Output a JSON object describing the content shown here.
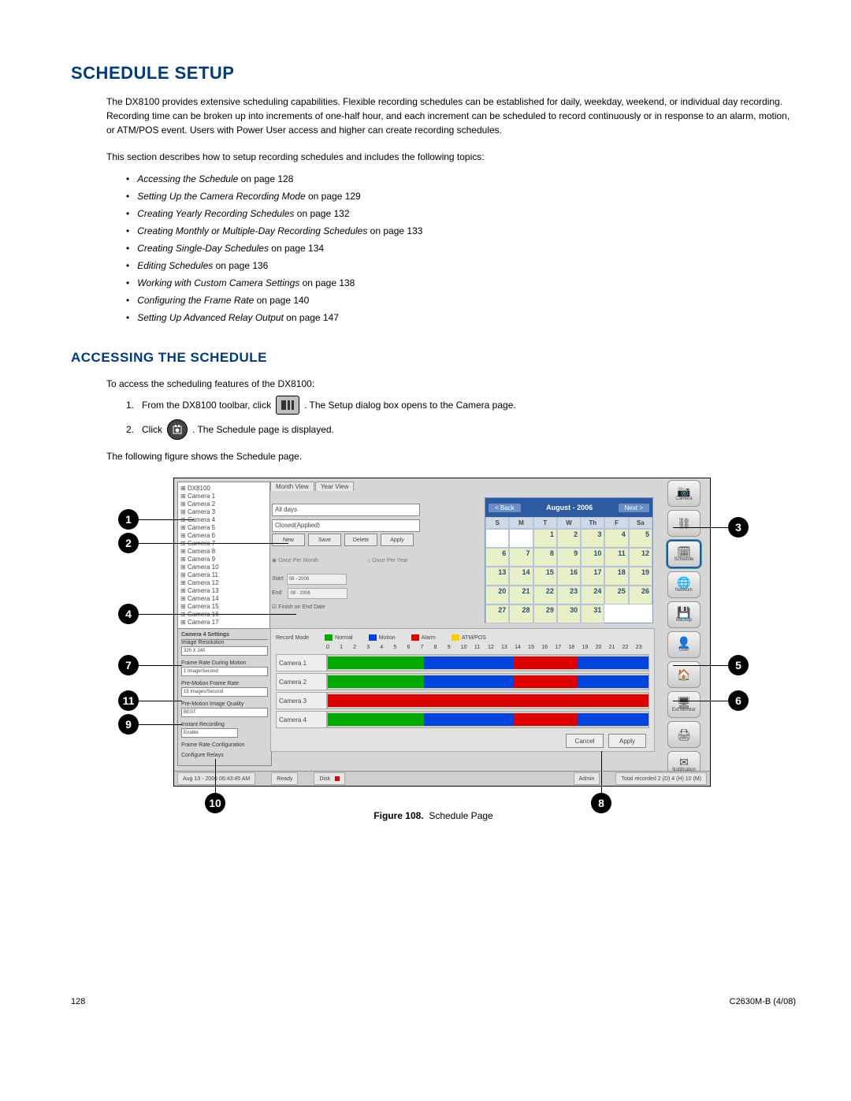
{
  "headings": {
    "h1": "SCHEDULE SETUP",
    "h2": "ACCESSING THE SCHEDULE"
  },
  "intro": {
    "p1": "The DX8100 provides extensive scheduling capabilities. Flexible recording schedules can be established for daily, weekday, weekend, or individual day recording. Recording time can be broken up into increments of one-half hour, and each increment can be scheduled to record continuously or in response to an alarm, motion, or ATM/POS event. Users with Power User access and higher can create recording schedules.",
    "p2": "This section describes how to setup recording schedules and includes the following topics:"
  },
  "topics": [
    {
      "ital": "Accessing the Schedule",
      "rest": " on page 128"
    },
    {
      "ital": "Setting Up the Camera Recording Mode",
      "rest": " on page 129"
    },
    {
      "ital": "Creating Yearly Recording Schedules",
      "rest": " on page 132"
    },
    {
      "ital": "Creating Monthly or Multiple-Day Recording Schedules",
      "rest": " on page 133"
    },
    {
      "ital": "Creating Single-Day Schedules",
      "rest": " on page 134"
    },
    {
      "ital": "Editing Schedules",
      "rest": " on page 136"
    },
    {
      "ital": "Working with Custom Camera Settings",
      "rest": " on page 138"
    },
    {
      "ital": "Configuring the Frame Rate",
      "rest": " on page 140"
    },
    {
      "ital": "Setting Up Advanced Relay Output",
      "rest": " on page 147"
    }
  ],
  "access": {
    "lead": "To access the scheduling features of the DX8100:",
    "step1a": "From the DX8100 toolbar, click",
    "step1b": ". The Setup dialog box opens to the Camera page.",
    "step2a": "Click",
    "step2b": ". The Schedule page is displayed.",
    "after": "The following figure shows the Schedule page."
  },
  "figure": {
    "label": "Figure 108.",
    "caption": "Schedule Page"
  },
  "callouts": {
    "1": "1",
    "2": "2",
    "3": "3",
    "4": "4",
    "5": "5",
    "6": "6",
    "7": "7",
    "8": "8",
    "9": "9",
    "10": "10",
    "11": "11"
  },
  "shot": {
    "tree_root": "DX8100",
    "cameras": [
      "Camera 1",
      "Camera 2",
      "Camera 3",
      "Camera 4",
      "Camera 5",
      "Camera 6",
      "Camera 7",
      "Camera 8",
      "Camera 9",
      "Camera 10",
      "Camera 11",
      "Camera 12",
      "Camera 13",
      "Camera 14",
      "Camera 15",
      "Camera 16",
      "Camera 17"
    ],
    "settings_title": "Camera 4 Settings",
    "settings": {
      "image_res_label": "Image Resolution",
      "image_res_value": "320 X 240",
      "frame_motion_label": "Frame Rate During Motion",
      "frame_motion_value": "1 Image/Second",
      "pre_motion_label": "Pre-Motion Frame Rate",
      "pre_motion_value": "15 Images/Second",
      "pre_quality_label": "Pre-Motion Image Quality",
      "pre_quality_value": "BEST",
      "instant_label": "Instant Recording",
      "instant_value": "Enable",
      "frame_conf_label": "Frame Rate Configuration",
      "relays_label": "Configure Relays"
    },
    "tabs": {
      "month": "Month View",
      "year": "Year View"
    },
    "dd_days": "All days",
    "dd_sched": "Closed(Applied)",
    "btns": {
      "new": "New",
      "save": "Save",
      "delete": "Delete",
      "apply": "Apply"
    },
    "radio_month": "Once Per Month",
    "radio_year": "Once Per Year",
    "start_label": "Start",
    "end_label": "End",
    "start_val": "08 - 2006",
    "end_val": "08 - 2006",
    "finish_end": "Finish on End Date",
    "calendar": {
      "back": "< Back",
      "next": "Next >",
      "title": "August - 2006",
      "dow": [
        "S",
        "M",
        "T",
        "W",
        "Th",
        "F",
        "Sa"
      ],
      "leading_blanks": 2,
      "days": 31
    },
    "legend": {
      "title": "Record Mode",
      "normal": "Normal",
      "motion": "Motion",
      "alarm": "Alarm",
      "atm": "ATM/POS"
    },
    "timeline": {
      "hours": [
        "0",
        "1",
        "2",
        "3",
        "4",
        "5",
        "6",
        "7",
        "8",
        "9",
        "10",
        "11",
        "12",
        "13",
        "14",
        "15",
        "16",
        "17",
        "18",
        "19",
        "20",
        "21",
        "22",
        "23"
      ],
      "rows": [
        "Camera 1",
        "Camera 2",
        "Camera 3",
        "Camera 4"
      ]
    },
    "bottom": {
      "cancel": "Cancel",
      "apply": "Apply"
    },
    "status": {
      "date": "Aug 13 - 2006  06:43:45 AM",
      "ready": "Ready",
      "disk": "Disk",
      "user": "Admin",
      "total": "Total recorded 2 (D) 4 (H) 10 (M)"
    },
    "right_icons": [
      {
        "name": "camera-icon",
        "label": "Camera",
        "glyph": "📷"
      },
      {
        "name": "link-icon",
        "label": "",
        "glyph": "⛓"
      },
      {
        "name": "schedule-icon",
        "label": "Schedule",
        "glyph": "🗓",
        "selected": true
      },
      {
        "name": "network-icon",
        "label": "Network",
        "glyph": "🌐"
      },
      {
        "name": "backup-icon",
        "label": "Backup",
        "glyph": "💾"
      },
      {
        "name": "user-icon",
        "label": "User",
        "glyph": "👤"
      },
      {
        "name": "site-icon",
        "label": "",
        "glyph": "🏠"
      },
      {
        "name": "ext-monitor-icon",
        "label": "Ext Monitor",
        "glyph": "🖥"
      },
      {
        "name": "printer-icon",
        "label": "",
        "glyph": "🖨"
      },
      {
        "name": "notification-icon",
        "label": "Notification",
        "glyph": "✉"
      }
    ]
  },
  "footer": {
    "page": "128",
    "doc": "C2630M-B (4/08)"
  }
}
